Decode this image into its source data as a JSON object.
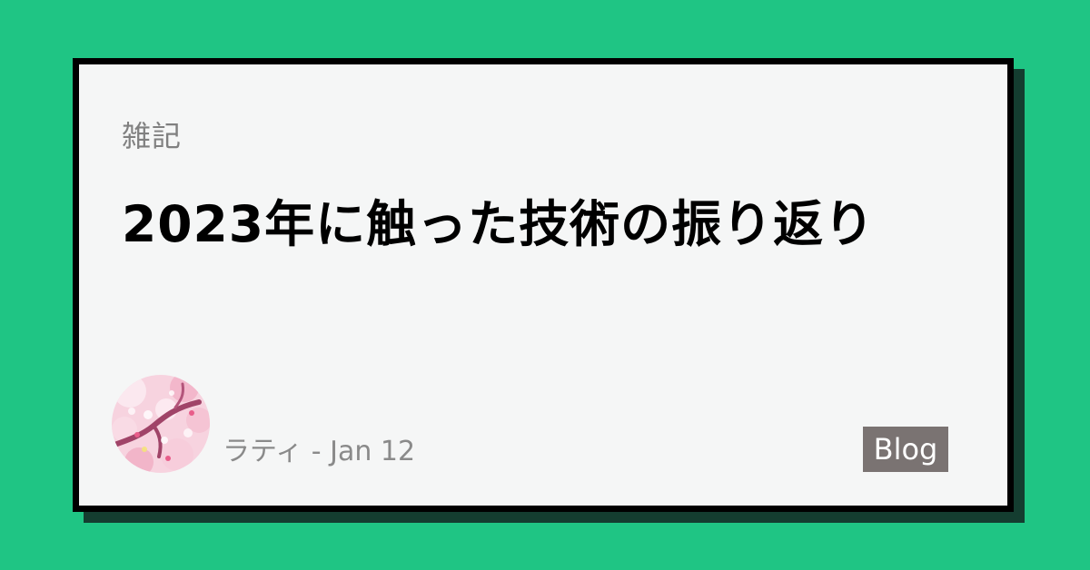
{
  "colors": {
    "background": "#1fc584",
    "card": "#f5f6f6",
    "card_border": "#000000",
    "tag_background": "#7a7372"
  },
  "post": {
    "category": "雑記",
    "title": "2023年に触った技術の振り返り",
    "author": "ラティ",
    "date": "Jan 12",
    "tag": "Blog"
  },
  "avatar": {
    "icon": "cherry-blossom-avatar-icon"
  }
}
